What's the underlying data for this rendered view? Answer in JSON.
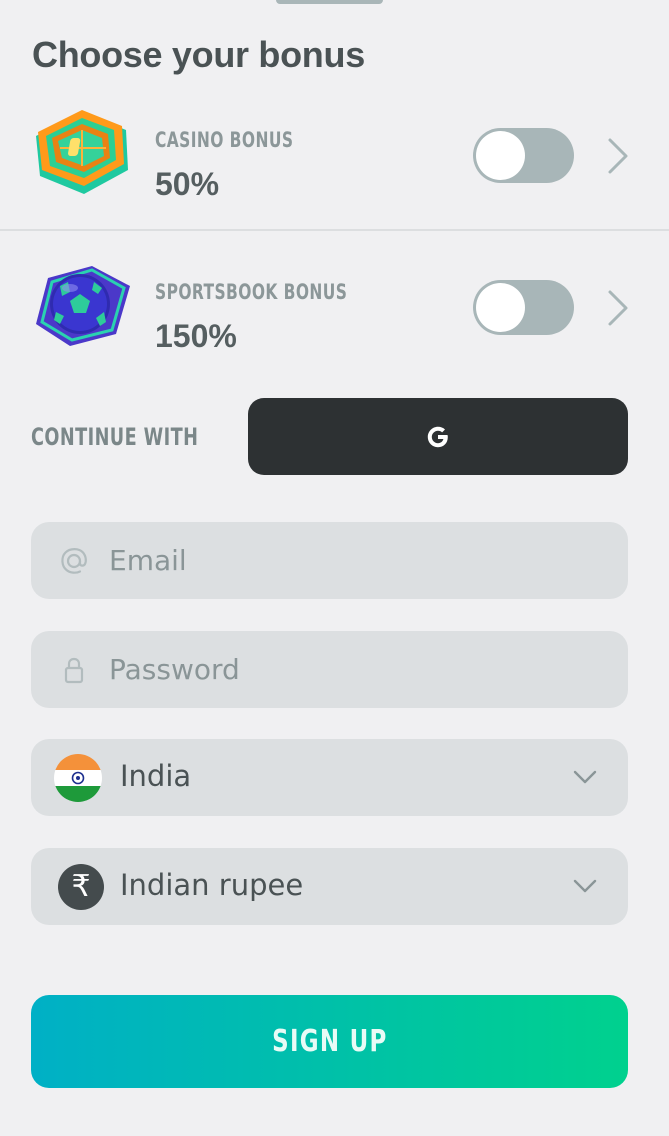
{
  "page": {
    "title": "Choose your bonus"
  },
  "bonuses": [
    {
      "label": "CASINO BONUS",
      "value": "50%",
      "icon": "casino-roulette-icon",
      "enabled": false
    },
    {
      "label": "SPORTSBOOK BONUS",
      "value": "150%",
      "icon": "soccer-ball-icon",
      "enabled": false
    }
  ],
  "social": {
    "label": "CONTINUE WITH",
    "provider_icon": "google-g-icon"
  },
  "form": {
    "email": {
      "placeholder": "Email",
      "value": ""
    },
    "password": {
      "placeholder": "Password",
      "value": ""
    },
    "country": {
      "value": "India",
      "icon": "india-flag-icon"
    },
    "currency": {
      "value": "Indian rupee",
      "symbol": "₹"
    }
  },
  "signup": {
    "label": "SIGN UP"
  },
  "colors": {
    "toggle_off": "#a8b6b8",
    "google_button": "#2d3133",
    "signup_gradient_start": "#00b0c6",
    "signup_gradient_end": "#00d18e"
  }
}
